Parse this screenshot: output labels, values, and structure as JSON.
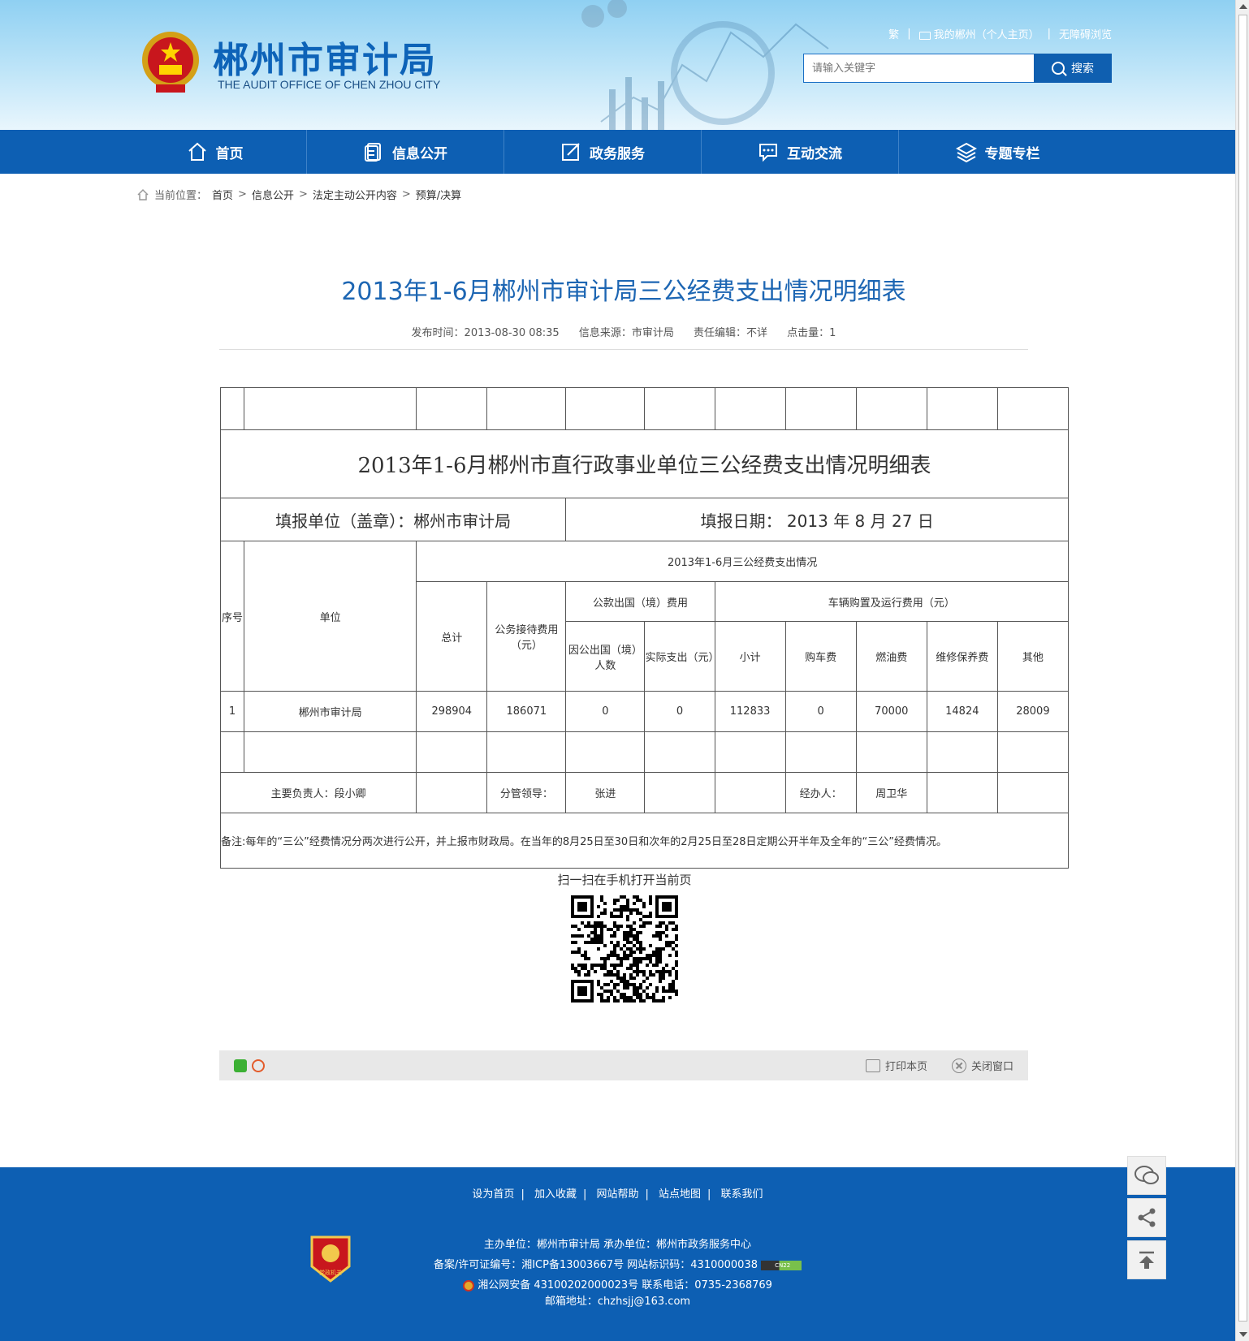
{
  "header": {
    "title": "郴州市审计局",
    "subtitle": "THE AUDIT OFFICE OF CHEN ZHOU CITY",
    "toplinks": {
      "traditional": "繁",
      "my_portal": "我的郴州（个人主页）",
      "accessible": "无障碍浏览"
    },
    "search": {
      "placeholder": "请输入关键字",
      "button": "搜索"
    }
  },
  "nav": [
    {
      "label": "首页",
      "icon": "home-icon"
    },
    {
      "label": "信息公开",
      "icon": "document-icon"
    },
    {
      "label": "政务服务",
      "icon": "edit-icon"
    },
    {
      "label": "互动交流",
      "icon": "chat-icon"
    },
    {
      "label": "专题专栏",
      "icon": "layers-icon"
    }
  ],
  "breadcrumb": {
    "prefix": "当前位置：",
    "items": [
      "首页",
      "信息公开",
      "法定主动公开内容",
      "预算/决算"
    ],
    "sep": ">"
  },
  "article": {
    "title": "2013年1-6月郴州市审计局三公经费支出情况明细表",
    "meta": {
      "publish": "发布时间：2013-08-30 08:35",
      "source": "信息来源：市审计局",
      "editor": "责任编辑：不详",
      "clicks": "点击量：1"
    }
  },
  "table": {
    "title": "2013年1-6月郴州市直行政事业单位三公经费支出情况明细表",
    "fill_unit": "填报单位（盖章）：郴州市审计局",
    "fill_date": "填报日期： 2013 年 8 月 27 日",
    "headers": {
      "seq": "序号",
      "unit": "单位",
      "group": "2013年1-6月三公经费支出情况",
      "total": "总计",
      "reception": "公务接待费用（元）",
      "abroad": "公款出国（境）费用",
      "abroad_people": "因公出国（境）人数",
      "abroad_actual": "实际支出（元）",
      "vehicle": "车辆购置及运行费用（元）",
      "subtotal": "小计",
      "purchase": "购车费",
      "fuel": "燃油费",
      "maintain": "维修保养费",
      "other": "其他"
    },
    "row": {
      "seq": "1",
      "unit": "郴州市审计局",
      "total": "298904",
      "reception": "186071",
      "abroad_people": "0",
      "abroad_actual": "0",
      "subtotal": "112833",
      "purchase": "0",
      "fuel": "70000",
      "maintain": "14824",
      "other": "28009"
    },
    "signoff": {
      "head": "主要负责人：段小卿",
      "leader_label": "分管领导：",
      "leader": "张进",
      "handler_label": "经办人：",
      "handler": "周卫华"
    },
    "note": "备注:每年的“三公”经费情况分两次进行公开，并上报市财政局。在当年的8月25日至30日和次年的2月25日至28日定期公开半年及全年的“三公”经费情况。"
  },
  "qr": {
    "caption": "扫一扫在手机打开当前页"
  },
  "toolbar": {
    "print": "打印本页",
    "close": "关闭窗口"
  },
  "footer": {
    "links": [
      "设为首页",
      "加入收藏",
      "网站帮助",
      "站点地图",
      "联系我们"
    ],
    "line1": "主办单位：郴州市审计局   承办单位：郴州市政务服务中心",
    "line2": "备案/许可证编号：湘ICP备13003667号   网站标识码：4310000038",
    "line3": "湘公网安备 43100202000023号   联系电话：0735-2368769",
    "line4": "邮箱地址：chzhsjj@163.com",
    "badge_text": "党政机关",
    "cn22": "CN22"
  },
  "colors": {
    "brand": "#0d5fb3",
    "title_blue": "#1d66b3"
  }
}
